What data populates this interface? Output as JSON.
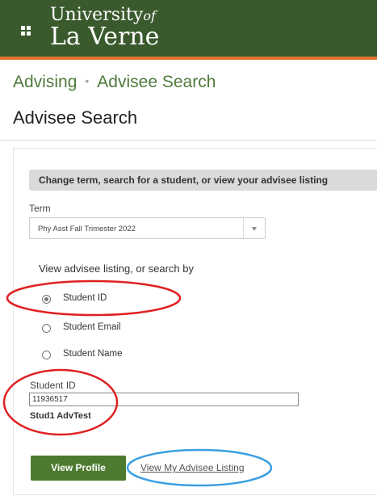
{
  "header": {
    "logo_line1": "University",
    "logo_of": "of",
    "logo_line2": "La Verne",
    "icon": "grid-icon",
    "bg_color": "#3a5a2d",
    "accent_color": "#e0742a"
  },
  "breadcrumb": {
    "items": [
      "Advising",
      "Advisee Search"
    ],
    "separator": "•"
  },
  "page": {
    "title": "Advisee Search"
  },
  "panel": {
    "bar_text": "Change term, search for a student, or view your advisee listing",
    "term_label": "Term",
    "term_value": "Phy Asst Fall Trimester 2022",
    "search_by_label": "View advisee listing, or search by",
    "options": [
      {
        "label": "Student ID",
        "selected": true
      },
      {
        "label": "Student Email",
        "selected": false
      },
      {
        "label": "Student Name",
        "selected": false
      }
    ],
    "id_label": "Student ID",
    "id_value": "11936517",
    "student_name": "Stud1 AdvTest",
    "view_profile_label": "View Profile",
    "view_listing_label": "View My Advisee Listing",
    "button_color": "#4d7a2f"
  },
  "annotations": {
    "red_color": "#e02020",
    "blue_color": "#3aa0e0"
  }
}
